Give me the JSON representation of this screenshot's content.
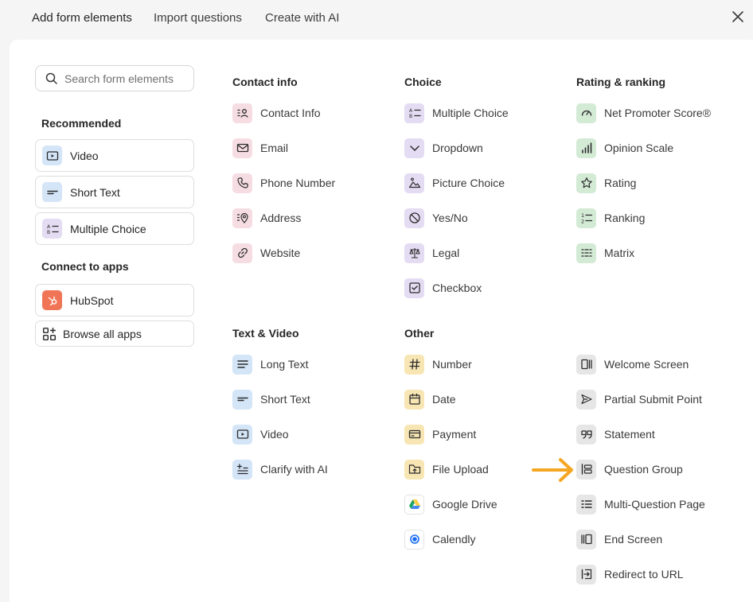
{
  "header": {
    "tabs": [
      "Add form elements",
      "Import questions",
      "Create with AI"
    ]
  },
  "search": {
    "placeholder": "Search form elements"
  },
  "sidebar": {
    "recommended_title": "Recommended",
    "recommended": [
      {
        "label": "Video",
        "icon": "video-icon"
      },
      {
        "label": "Short Text",
        "icon": "short-text-icon"
      },
      {
        "label": "Multiple Choice",
        "icon": "multiple-choice-icon"
      }
    ],
    "apps_title": "Connect to apps",
    "apps": [
      {
        "label": "HubSpot",
        "icon": "hubspot-icon"
      },
      {
        "label": "Browse all apps",
        "icon": "apps-grid-icon"
      }
    ]
  },
  "columns": {
    "contact": {
      "title": "Contact info",
      "items": [
        "Contact Info",
        "Email",
        "Phone Number",
        "Address",
        "Website"
      ]
    },
    "choice": {
      "title": "Choice",
      "items": [
        "Multiple Choice",
        "Dropdown",
        "Picture Choice",
        "Yes/No",
        "Legal",
        "Checkbox"
      ]
    },
    "rating": {
      "title": "Rating & ranking",
      "items": [
        "Net Promoter Score®",
        "Opinion Scale",
        "Rating",
        "Ranking",
        "Matrix"
      ]
    },
    "textvideo": {
      "title": "Text & Video",
      "items": [
        "Long Text",
        "Short Text",
        "Video",
        "Clarify with AI"
      ]
    },
    "other": {
      "title": "Other",
      "items": [
        "Number",
        "Date",
        "Payment",
        "File Upload",
        "Google Drive",
        "Calendly"
      ]
    },
    "screens": {
      "items": [
        "Welcome Screen",
        "Partial Submit Point",
        "Statement",
        "Question Group",
        "Multi-Question Page",
        "End Screen",
        "Redirect to URL"
      ]
    }
  },
  "colors": {
    "contact": "#f6dde3",
    "choice": "#e4dcf3",
    "rating": "#d3ead5",
    "textvideo": "#d3e5f7",
    "other": "#f7e6b3",
    "screens": "#e6e6e6",
    "arrow": "#f5a623",
    "hubspot": "#f07556"
  }
}
